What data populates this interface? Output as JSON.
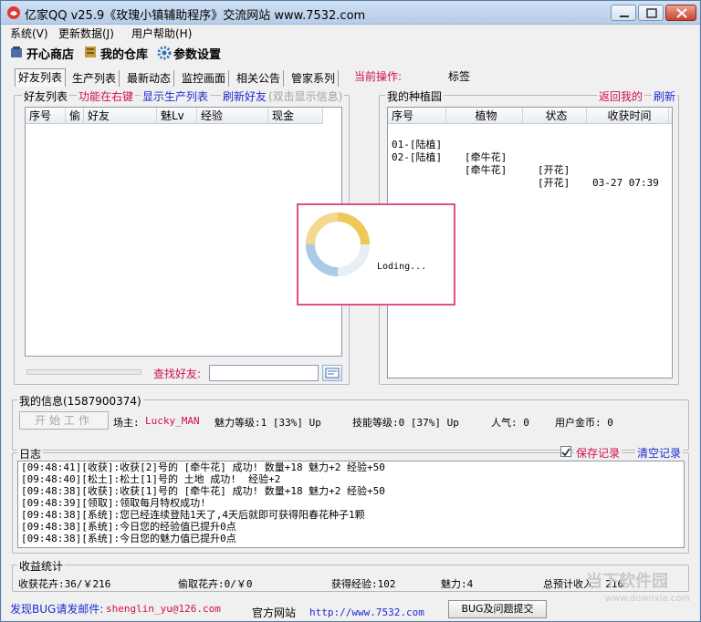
{
  "window": {
    "title": "亿家QQ v25.9《玫瑰小镇辅助程序》交流网站  www.7532.com"
  },
  "menu": [
    "系统(V)",
    "更新数据(J)",
    "用户帮助(H)"
  ],
  "toolbar": {
    "shop": "开心商店",
    "warehouse": "我的仓库",
    "settings": "参数设置"
  },
  "tabs": [
    "好友列表",
    "生产列表",
    "最新动态",
    "监控画面",
    "相关公告",
    "管家系列"
  ],
  "current_op": {
    "label": "当前操作:",
    "value": "标签"
  },
  "friends": {
    "group_label": "好友列表",
    "link_rightclick": "功能在右键",
    "link_show_production": "显示生产列表",
    "link_refresh": "刷新好友",
    "hint": "(双击显示信息)",
    "columns": [
      "序号",
      "偷",
      "好友",
      "魅Lv",
      "经验",
      "现金"
    ],
    "search_label": "查找好友:",
    "search_value": ""
  },
  "garden": {
    "group_label": "我的种植园",
    "link_back": "返回我的",
    "link_refresh": "刷新",
    "columns": [
      "序号",
      "植物",
      "状态",
      "收获时间"
    ],
    "rows": [
      {
        "id": "01-[陆植]",
        "plant": "[牵牛花]",
        "status": "[开花]",
        "time": "03-27 07:39"
      },
      {
        "id": "02-[陆植]",
        "plant": "[牵牛花]",
        "status": "[开花]",
        "time": ""
      }
    ]
  },
  "loading": {
    "text": "Loding..."
  },
  "myinfo": {
    "group_label": "我的信息(1587900374)",
    "start_button": "开始工作",
    "owner_label": "场主:",
    "owner_name": "Lucky_MAN",
    "charm_level": "魅力等级:1 [33%] Up",
    "skill_level": "技能等级:0 [37%] Up",
    "popularity": "人气: 0",
    "gold": "用户金币: 0"
  },
  "log": {
    "group_label": "日志",
    "save_label": "保存记录",
    "save_checked": true,
    "clear_label": "清空记录",
    "lines": [
      "[09:48:41][收获]:收获[2]号的 [牵牛花] 成功! 数量+18 魅力+2 经验+50",
      "[09:48:40][松土]:松土[1]号的 土地 成功!  经验+2",
      "[09:48:38][收获]:收获[1]号的 [牵牛花] 成功! 数量+18 魅力+2 经验+50",
      "[09:48:39][领取]:领取每月特权成功!",
      "[09:48:38][系统]:您已经连续登陆1天了,4天后就即可获得阳春花种子1颗",
      "[09:48:38][系统]:今日您的经验值已提升0点",
      "[09:48:38][系统]:今日您的魅力值已提升0点"
    ]
  },
  "stats": {
    "group_label": "收益统计",
    "harvest": "收获花卉:36/￥216",
    "steal": "偷取花卉:0/￥0",
    "exp": "获得经验:102",
    "charm": "魅力:4",
    "total": "总预计收入: 216"
  },
  "footer": {
    "bug_label": "发现BUG请发邮件:",
    "email": "shenglin_yu@126.com",
    "site_label": "官方网站",
    "site_url": "http://www.7532.com",
    "bug_button": "BUG及问题提交"
  },
  "watermark": {
    "brand": "当下软件园",
    "url": "www.downxia.com"
  },
  "colors": {
    "accent_red": "#d0104c",
    "link_blue": "#1e2ad0",
    "loading_border": "#e04e8b"
  }
}
